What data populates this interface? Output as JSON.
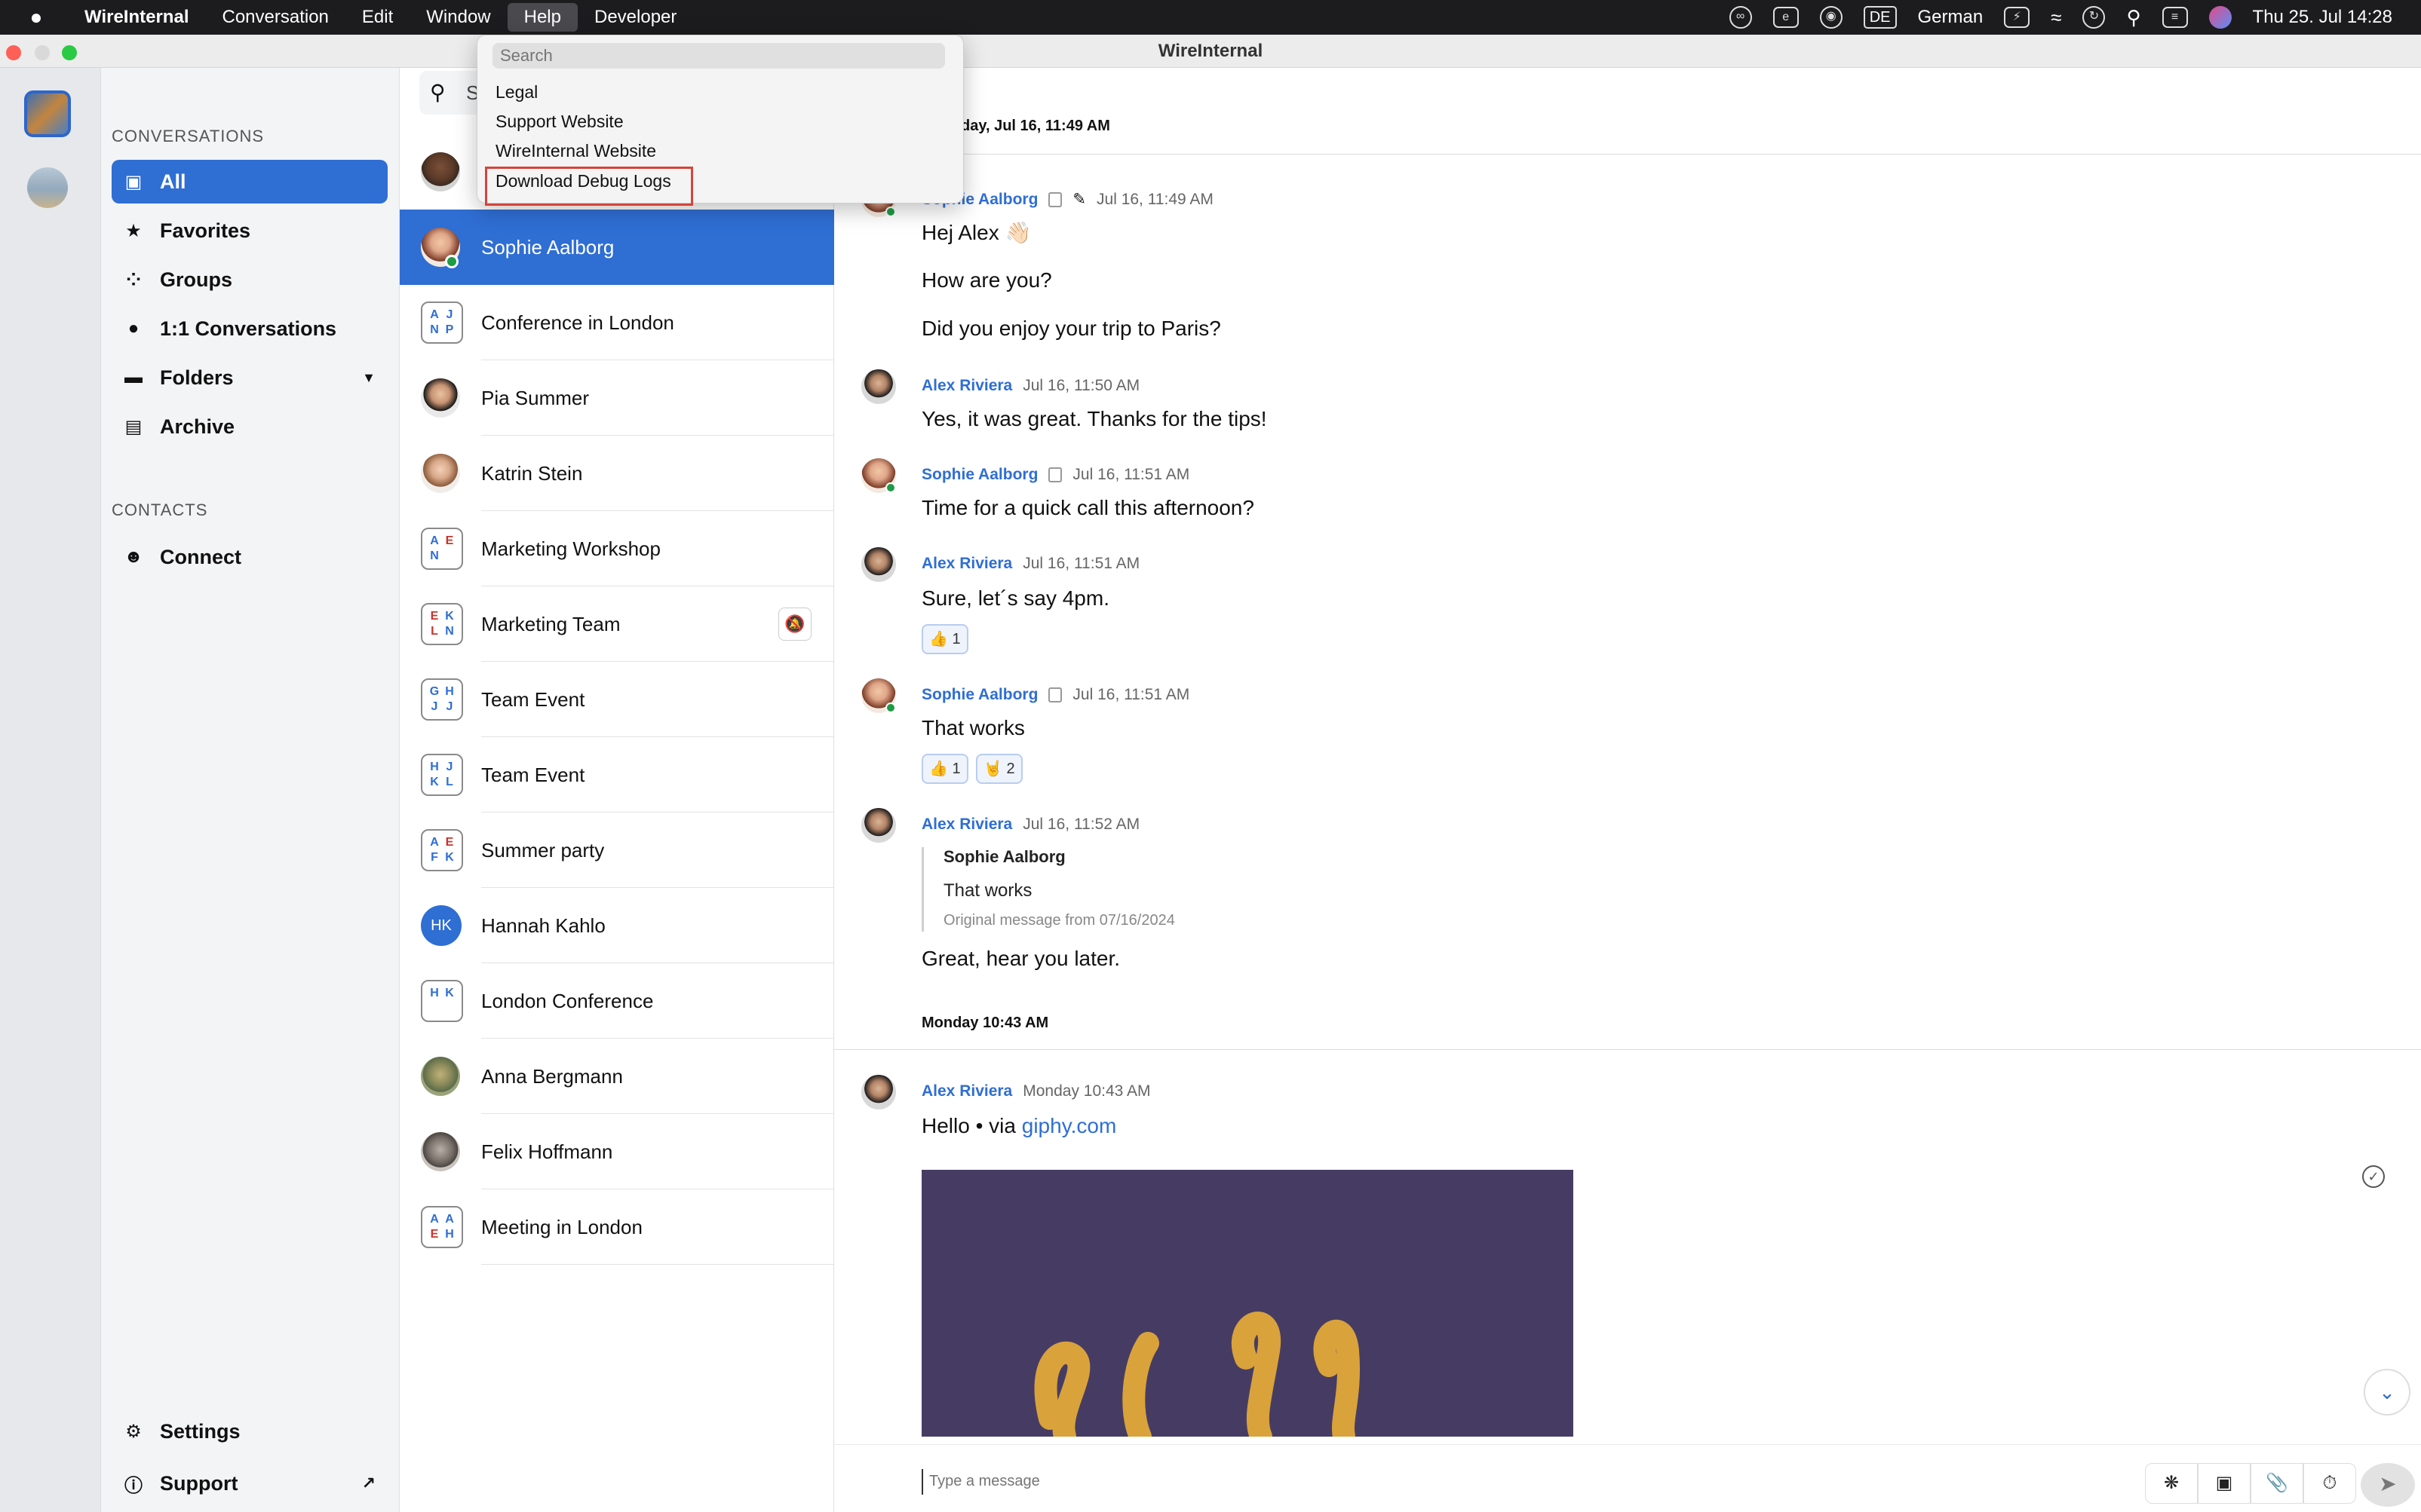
{
  "menubar": {
    "app_name": "WireInternal",
    "menus": [
      "Conversation",
      "Edit",
      "Window",
      "Help",
      "Developer"
    ],
    "language_badge": "DE",
    "language": "German",
    "clock": "Thu 25. Jul  14:28"
  },
  "window": {
    "title": "WireInternal"
  },
  "help_menu": {
    "search_placeholder": "Search",
    "items": [
      "Legal",
      "Support Website",
      "WireInternal Website",
      "Download Debug Logs"
    ]
  },
  "sidebar": {
    "conversations_label": "CONVERSATIONS",
    "nav": [
      {
        "label": "All",
        "icon": "chat-bubble-icon"
      },
      {
        "label": "Favorites",
        "icon": "star-icon"
      },
      {
        "label": "Groups",
        "icon": "groups-icon"
      },
      {
        "label": "1:1 Conversations",
        "icon": "person-icon"
      },
      {
        "label": "Folders",
        "icon": "folder-icon"
      },
      {
        "label": "Archive",
        "icon": "archive-icon"
      }
    ],
    "contacts_label": "CONTACTS",
    "connect_label": "Connect",
    "settings_label": "Settings",
    "support_label": "Support"
  },
  "conversation_list": {
    "search_prefix": "S",
    "items": [
      {
        "name": "Sophie Aalborg",
        "type": "person",
        "active": true
      },
      {
        "name": "Conference in London",
        "type": "group",
        "initials": [
          "A",
          "J",
          "N",
          "P"
        ]
      },
      {
        "name": "Pia Summer",
        "type": "person"
      },
      {
        "name": "Katrin Stein",
        "type": "person"
      },
      {
        "name": "Marketing Workshop",
        "type": "group",
        "initials": [
          "A",
          "E",
          "N",
          ""
        ]
      },
      {
        "name": "Marketing Team",
        "type": "group",
        "initials": [
          "E",
          "K",
          "L",
          "N"
        ],
        "muted": true
      },
      {
        "name": "Team Event",
        "type": "group",
        "initials": [
          "G",
          "H",
          "J",
          "J"
        ]
      },
      {
        "name": "Team Event",
        "type": "group",
        "initials": [
          "H",
          "J",
          "K",
          "L"
        ]
      },
      {
        "name": "Summer party",
        "type": "group",
        "initials": [
          "A",
          "E",
          "F",
          "K"
        ]
      },
      {
        "name": "Hannah Kahlo",
        "type": "initials",
        "initials_text": "HK"
      },
      {
        "name": "London Conference",
        "type": "group",
        "initials": [
          "H",
          "K",
          "",
          ""
        ]
      },
      {
        "name": "Anna Bergmann",
        "type": "person"
      },
      {
        "name": "Felix Hoffmann",
        "type": "person"
      },
      {
        "name": "Meeting in London",
        "type": "group",
        "initials": [
          "A",
          "A",
          "E",
          "H"
        ]
      }
    ]
  },
  "chat": {
    "day_separator_1": "day, Jul 16, 11:49 AM",
    "messages": [
      {
        "author": "Sophie Aalborg",
        "time": "Jul 16, 11:49 AM",
        "lines": [
          "Hej Alex 👋🏻",
          "How are you?",
          "Did you enjoy your trip to Paris?"
        ]
      },
      {
        "author": "Alex Riviera",
        "time": "Jul 16, 11:50 AM",
        "lines": [
          "Yes, it was great. Thanks for the tips!"
        ]
      },
      {
        "author": "Sophie Aalborg",
        "time": "Jul 16, 11:51 AM",
        "lines": [
          "Time for a quick call this afternoon?"
        ]
      },
      {
        "author": "Alex Riviera",
        "time": "Jul 16, 11:51 AM",
        "lines": [
          "Sure, let´s say 4pm."
        ],
        "reactions": [
          "👍 1"
        ]
      },
      {
        "author": "Sophie Aalborg",
        "time": "Jul 16, 11:51 AM",
        "lines": [
          "That works"
        ],
        "reactions": [
          "👍 1",
          "🤘 2"
        ]
      },
      {
        "author": "Alex Riviera",
        "time": "Jul 16, 11:52 AM",
        "quote": {
          "author": "Sophie Aalborg",
          "text": "That works",
          "original": "Original message from 07/16/2024"
        },
        "lines": [
          "Great, hear you later."
        ]
      }
    ],
    "day_separator_2": "Monday 10:43 AM",
    "last_message": {
      "author": "Alex Riviera",
      "time": "Monday 10:43 AM",
      "text_prefix": "Hello • via ",
      "link": "giphy.com"
    },
    "input_placeholder": "Type a message"
  },
  "colors": {
    "accent": "#2f6ed3",
    "online": "#1f9a45",
    "highlight_border": "#d6443b"
  }
}
